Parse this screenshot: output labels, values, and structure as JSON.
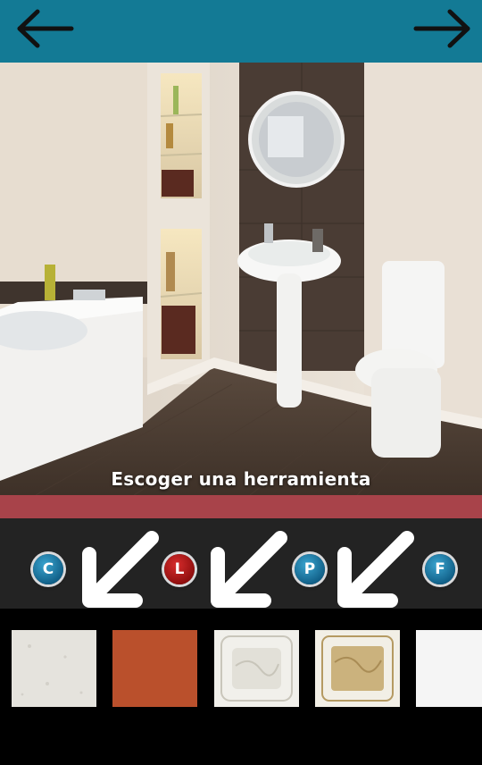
{
  "topbar": {
    "back_icon": "arrow-left-icon",
    "forward_icon": "arrow-right-icon",
    "color": "#137a95"
  },
  "scene": {
    "caption": "Escoger una herramienta"
  },
  "tools": [
    {
      "label": "C",
      "color": "#1a6f9a",
      "selected": false
    },
    {
      "label": "L",
      "color": "#b01515",
      "selected": true
    },
    {
      "label": "P",
      "color": "#1a6f9a",
      "selected": false
    },
    {
      "label": "F",
      "color": "#1a6f9a",
      "selected": false
    }
  ],
  "hint_arrow_icon": "arrow-down-left-icon",
  "swatches": [
    {
      "name": "white-speckled-tile",
      "color": "#e4e2dc"
    },
    {
      "name": "terracotta-tile",
      "color": "#c0542f"
    },
    {
      "name": "white-marble-framed-tile",
      "color": "#efeee9"
    },
    {
      "name": "gold-marble-framed-tile",
      "color": "#cdb787"
    },
    {
      "name": "plain-white-tile",
      "color": "#f4f4f4"
    }
  ],
  "accent_colors": {
    "redbar": "#a8434a",
    "toolbar": "#232323"
  }
}
